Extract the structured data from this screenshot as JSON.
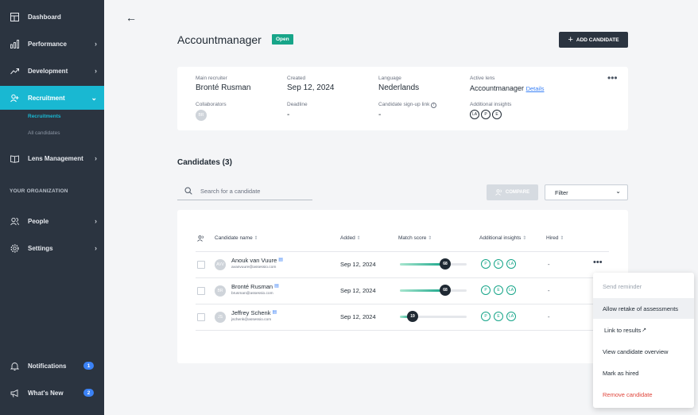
{
  "sidebar": {
    "items": [
      {
        "label": "Dashboard",
        "icon": "dashboard-icon"
      },
      {
        "label": "Performance",
        "icon": "bar-chart-icon"
      },
      {
        "label": "Development",
        "icon": "trending-up-icon"
      },
      {
        "label": "Recruitment",
        "icon": "user-plus-icon"
      },
      {
        "label": "Lens Management",
        "icon": "book-icon"
      },
      {
        "label": "People",
        "icon": "users-icon"
      },
      {
        "label": "Settings",
        "icon": "gear-icon"
      },
      {
        "label": "Notifications",
        "icon": "bell-icon",
        "badge": "1"
      },
      {
        "label": "What's New",
        "icon": "megaphone-icon",
        "badge": "2"
      }
    ],
    "subitems": [
      "Recruitments",
      "All candidates"
    ],
    "section_label": "YOUR ORGANIZATION",
    "active_color": "#19b8d2"
  },
  "header": {
    "title": "Accountmanager",
    "status": "Open",
    "add_button": "ADD CANDIDATE"
  },
  "info": {
    "main_recruiter_label": "Main recruiter",
    "main_recruiter": "Bronté Rusman",
    "created_label": "Created",
    "created": "Sep 12, 2024",
    "language_label": "Language",
    "language": "Nederlands",
    "active_lens_label": "Active lens",
    "active_lens": "Accountmanager",
    "details_link": "Details",
    "collaborators_label": "Collaborators",
    "collaborator_initials": "BR",
    "deadline_label": "Deadline",
    "deadline": "-",
    "signup_label": "Candidate sign-up link",
    "signup": "-",
    "insights_label": "Additional insights",
    "insights": [
      "LA",
      "P",
      "E"
    ]
  },
  "candidates": {
    "title": "Candidates (3)",
    "search_placeholder": "Search for a candidate",
    "compare_label": "COMPARE",
    "filter_label": "Filter",
    "columns": [
      "Candidate name",
      "Added",
      "Match score",
      "Additional insights",
      "Hired"
    ],
    "rows": [
      {
        "initials": "AVV",
        "name": "Anouk van Vuure",
        "email": "avanvuure@assessio.com",
        "added": "Sep 12, 2024",
        "score": 68,
        "insights": [
          "P",
          "E",
          "LA"
        ],
        "hired": "-"
      },
      {
        "initials": "BR",
        "name": "Bronté Rusman",
        "email": "brusman@assessio.com",
        "added": "Sep 12, 2024",
        "score": 68,
        "insights": [
          "P",
          "E",
          "LA"
        ],
        "hired": "-"
      },
      {
        "initials": "JS",
        "name": "Jeffrey Schenk",
        "email": "jschenk@assessio.com",
        "added": "Sep 12, 2024",
        "score": 19,
        "insights": [
          "P",
          "E",
          "LA"
        ],
        "hired": "-"
      }
    ]
  },
  "context_menu": {
    "items": [
      "Send reminder",
      "Allow retake of assessments",
      "Link to results",
      "View candidate overview",
      "Mark as hired",
      "Remove candidate"
    ]
  }
}
